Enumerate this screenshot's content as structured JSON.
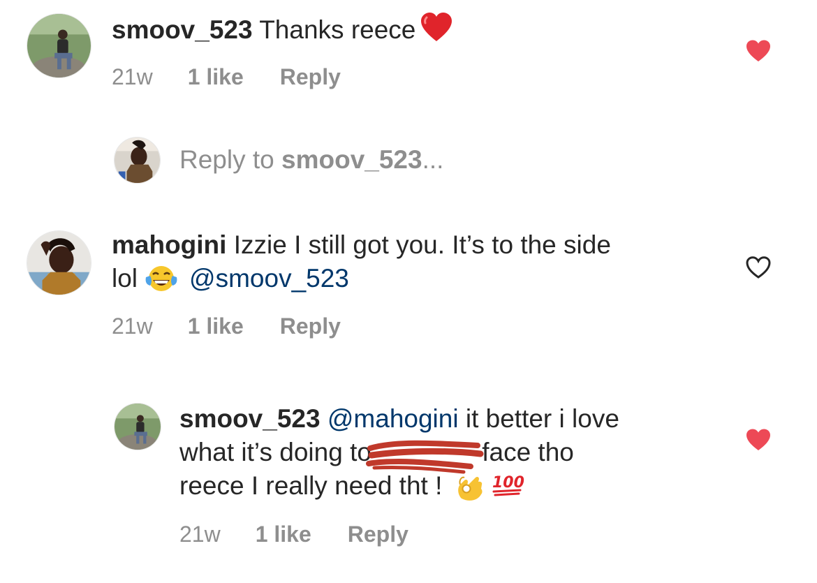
{
  "comments": [
    {
      "username": "smoov_523",
      "text": "Thanks reece",
      "emoji": "red-heart-emoji",
      "time": "21w",
      "likes": "1 like",
      "reply_label": "Reply",
      "liked": true
    },
    {
      "username": "mahogini",
      "line1": "Izzie I still got you. It’s to the side",
      "line2_prefix": "lol",
      "emoji": "tears-of-joy-emoji",
      "mention": "@smoov_523",
      "time": "21w",
      "likes": "1 like",
      "reply_label": "Reply",
      "liked": false
    }
  ],
  "reply_prompt": {
    "prefix": "Reply to",
    "username": "smoov_523",
    "suffix": "..."
  },
  "reply": {
    "username": "smoov_523",
    "mention": "@mahogini",
    "line1_rest": " it better i love",
    "line2_prefix": "what it’s doing to",
    "line2_suffix": "face tho",
    "line3": "reece I really need tht !",
    "emojis": [
      "ok-hand-emoji",
      "hundred-points-emoji"
    ],
    "time": "21w",
    "likes": "1 like",
    "reply_label": "Reply",
    "liked": true
  },
  "colors": {
    "text": "#262626",
    "secondary": "#8e8e8e",
    "mention": "#00376b",
    "liked_heart": "#ed4956",
    "redaction": "#c0392b"
  }
}
